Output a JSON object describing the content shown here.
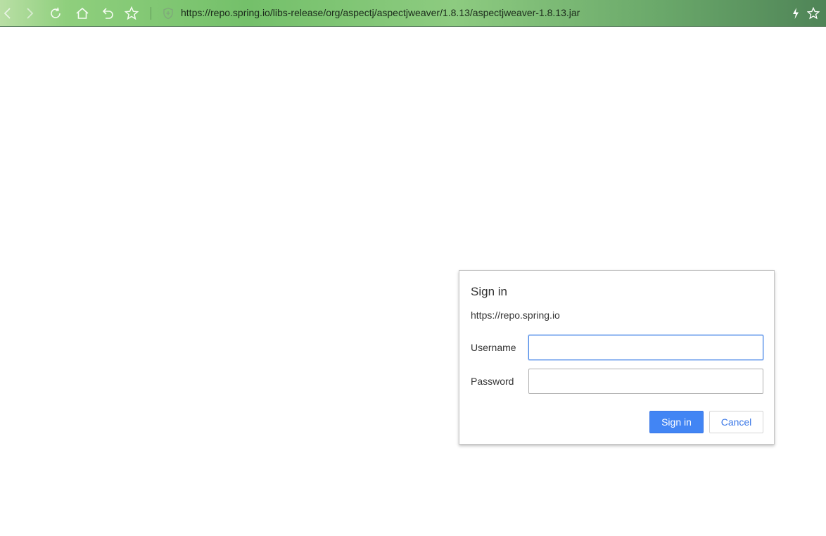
{
  "browser": {
    "url": "https://repo.spring.io/libs-release/org/aspectj/aspectjweaver/1.8.13/aspectjweaver-1.8.13.jar",
    "icons": [
      "back-icon",
      "forward-icon",
      "reload-icon",
      "home-icon",
      "undo-icon",
      "bookmark-star-icon",
      "shield-icon",
      "flash-icon",
      "favorite-star-icon"
    ]
  },
  "dialog": {
    "title": "Sign in",
    "origin": "https://repo.spring.io",
    "username_label": "Username",
    "username_value": "",
    "password_label": "Password",
    "password_value": "",
    "signin_label": "Sign in",
    "cancel_label": "Cancel"
  },
  "colors": {
    "accent": "#4285f4",
    "toolbar": "#74c06a"
  }
}
